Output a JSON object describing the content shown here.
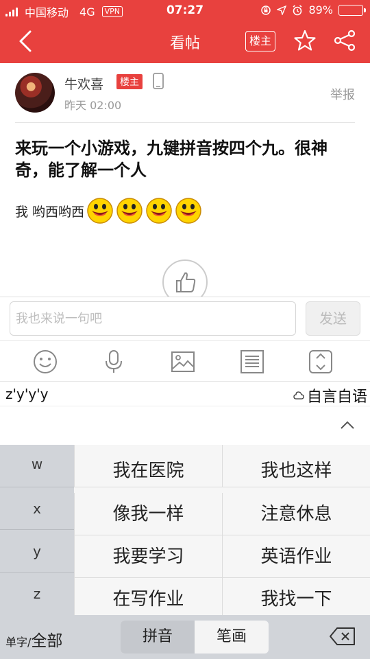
{
  "status": {
    "carrier": "中国移动",
    "network": "4G",
    "vpn": "VPN",
    "time": "07:27",
    "battery": "89%",
    "battery_level": 0.89,
    "battery_color": "#ffcb1f"
  },
  "header": {
    "title": "看帖",
    "louzhu_label": "楼主",
    "accent": "#e8413e"
  },
  "post": {
    "author": "牛欢喜",
    "badge": "楼主",
    "time": "昨天 02:00",
    "report": "举报",
    "title": "来玩一个小游戏，九键拼音按四个九。很神奇，能了解一个人",
    "body": "我 哟西哟西"
  },
  "comment": {
    "placeholder": "我也来说一句吧",
    "send": "发送"
  },
  "tools": [
    "smiley-icon",
    "microphone-icon",
    "image-icon",
    "list-icon",
    "expand-icon"
  ],
  "ime": {
    "composition": "z'y'y'y",
    "top_candidate": "自言自语",
    "letters": [
      "w",
      "x",
      "y",
      "z"
    ],
    "phrases": [
      "我在医院",
      "我也这样",
      "像我一样",
      "注意休息",
      "我要学习",
      "英语作业",
      "在写作业",
      "我找一下"
    ],
    "single_label": "单字/",
    "all_label": "全部",
    "mode_pinyin": "拼音",
    "mode_stroke": "笔画"
  }
}
